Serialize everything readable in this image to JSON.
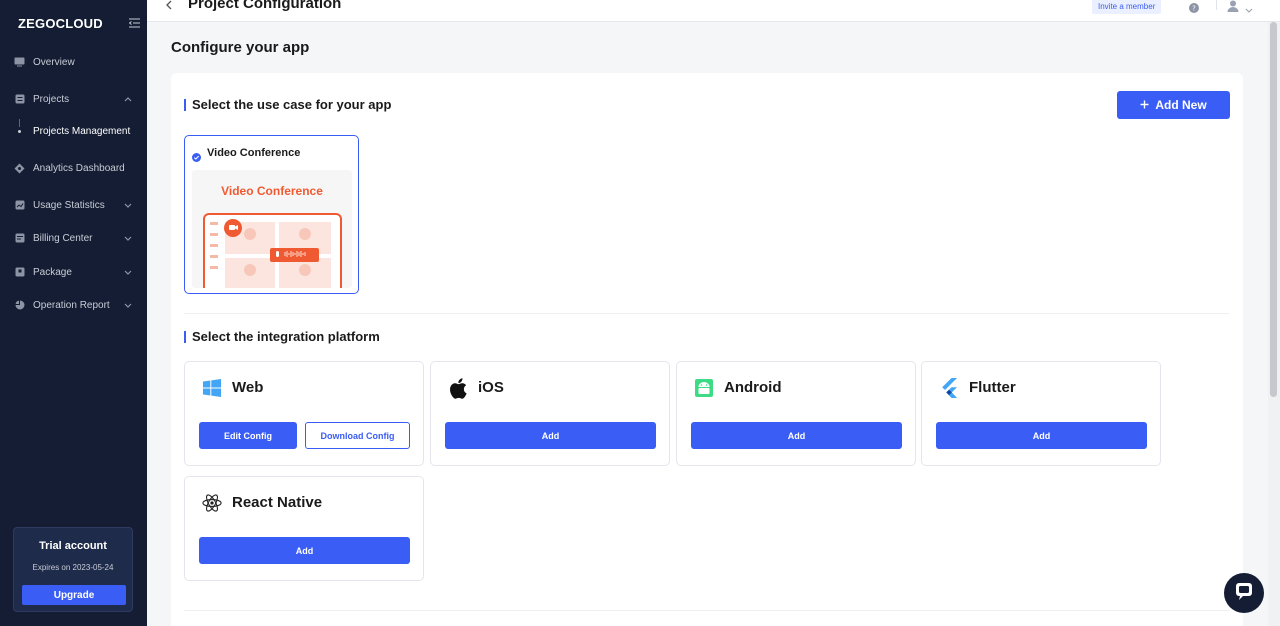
{
  "brand": {
    "logo": "ZEGOCLOUD"
  },
  "sidebar": {
    "items": [
      {
        "label": "Overview",
        "icon": "monitor-icon"
      },
      {
        "label": "Projects",
        "icon": "projects-icon"
      },
      {
        "label": "Analytics Dashboard",
        "icon": "analytics-icon"
      },
      {
        "label": "Usage Statistics",
        "icon": "usage-icon"
      },
      {
        "label": "Billing Center",
        "icon": "billing-icon"
      },
      {
        "label": "Package",
        "icon": "package-icon"
      },
      {
        "label": "Operation Report",
        "icon": "pie-chart-icon"
      }
    ],
    "subitem": "Projects Management",
    "trial": {
      "title": "Trial account",
      "expires": "Expires on 2023-05-24",
      "upgrade": "Upgrade"
    }
  },
  "topbar": {
    "title": "Project Configuration",
    "invite": "Invite a member"
  },
  "main": {
    "heading": "Configure your app",
    "usecase_section": "Select the use case for your app",
    "add_new": "Add New",
    "usecase": {
      "label": "Video Conference",
      "preview_title": "Video Conference"
    },
    "platform_section": "Select the integration platform",
    "platforms": [
      {
        "name": "Web",
        "icon": "windows-icon",
        "buttons": [
          "Edit Config",
          "Download Config"
        ]
      },
      {
        "name": "iOS",
        "icon": "apple-icon",
        "buttons": [
          "Add"
        ]
      },
      {
        "name": "Android",
        "icon": "android-icon",
        "buttons": [
          "Add"
        ]
      },
      {
        "name": "Flutter",
        "icon": "flutter-icon",
        "buttons": [
          "Add"
        ]
      },
      {
        "name": "React Native",
        "icon": "react-icon",
        "buttons": [
          "Add"
        ]
      }
    ]
  },
  "colors": {
    "sidebar_bg": "#141d33",
    "accent": "#3a5df5",
    "brand_orange": "#f05a32",
    "android_green": "#3ddc84",
    "flutter_blue": "#42a5f5"
  }
}
